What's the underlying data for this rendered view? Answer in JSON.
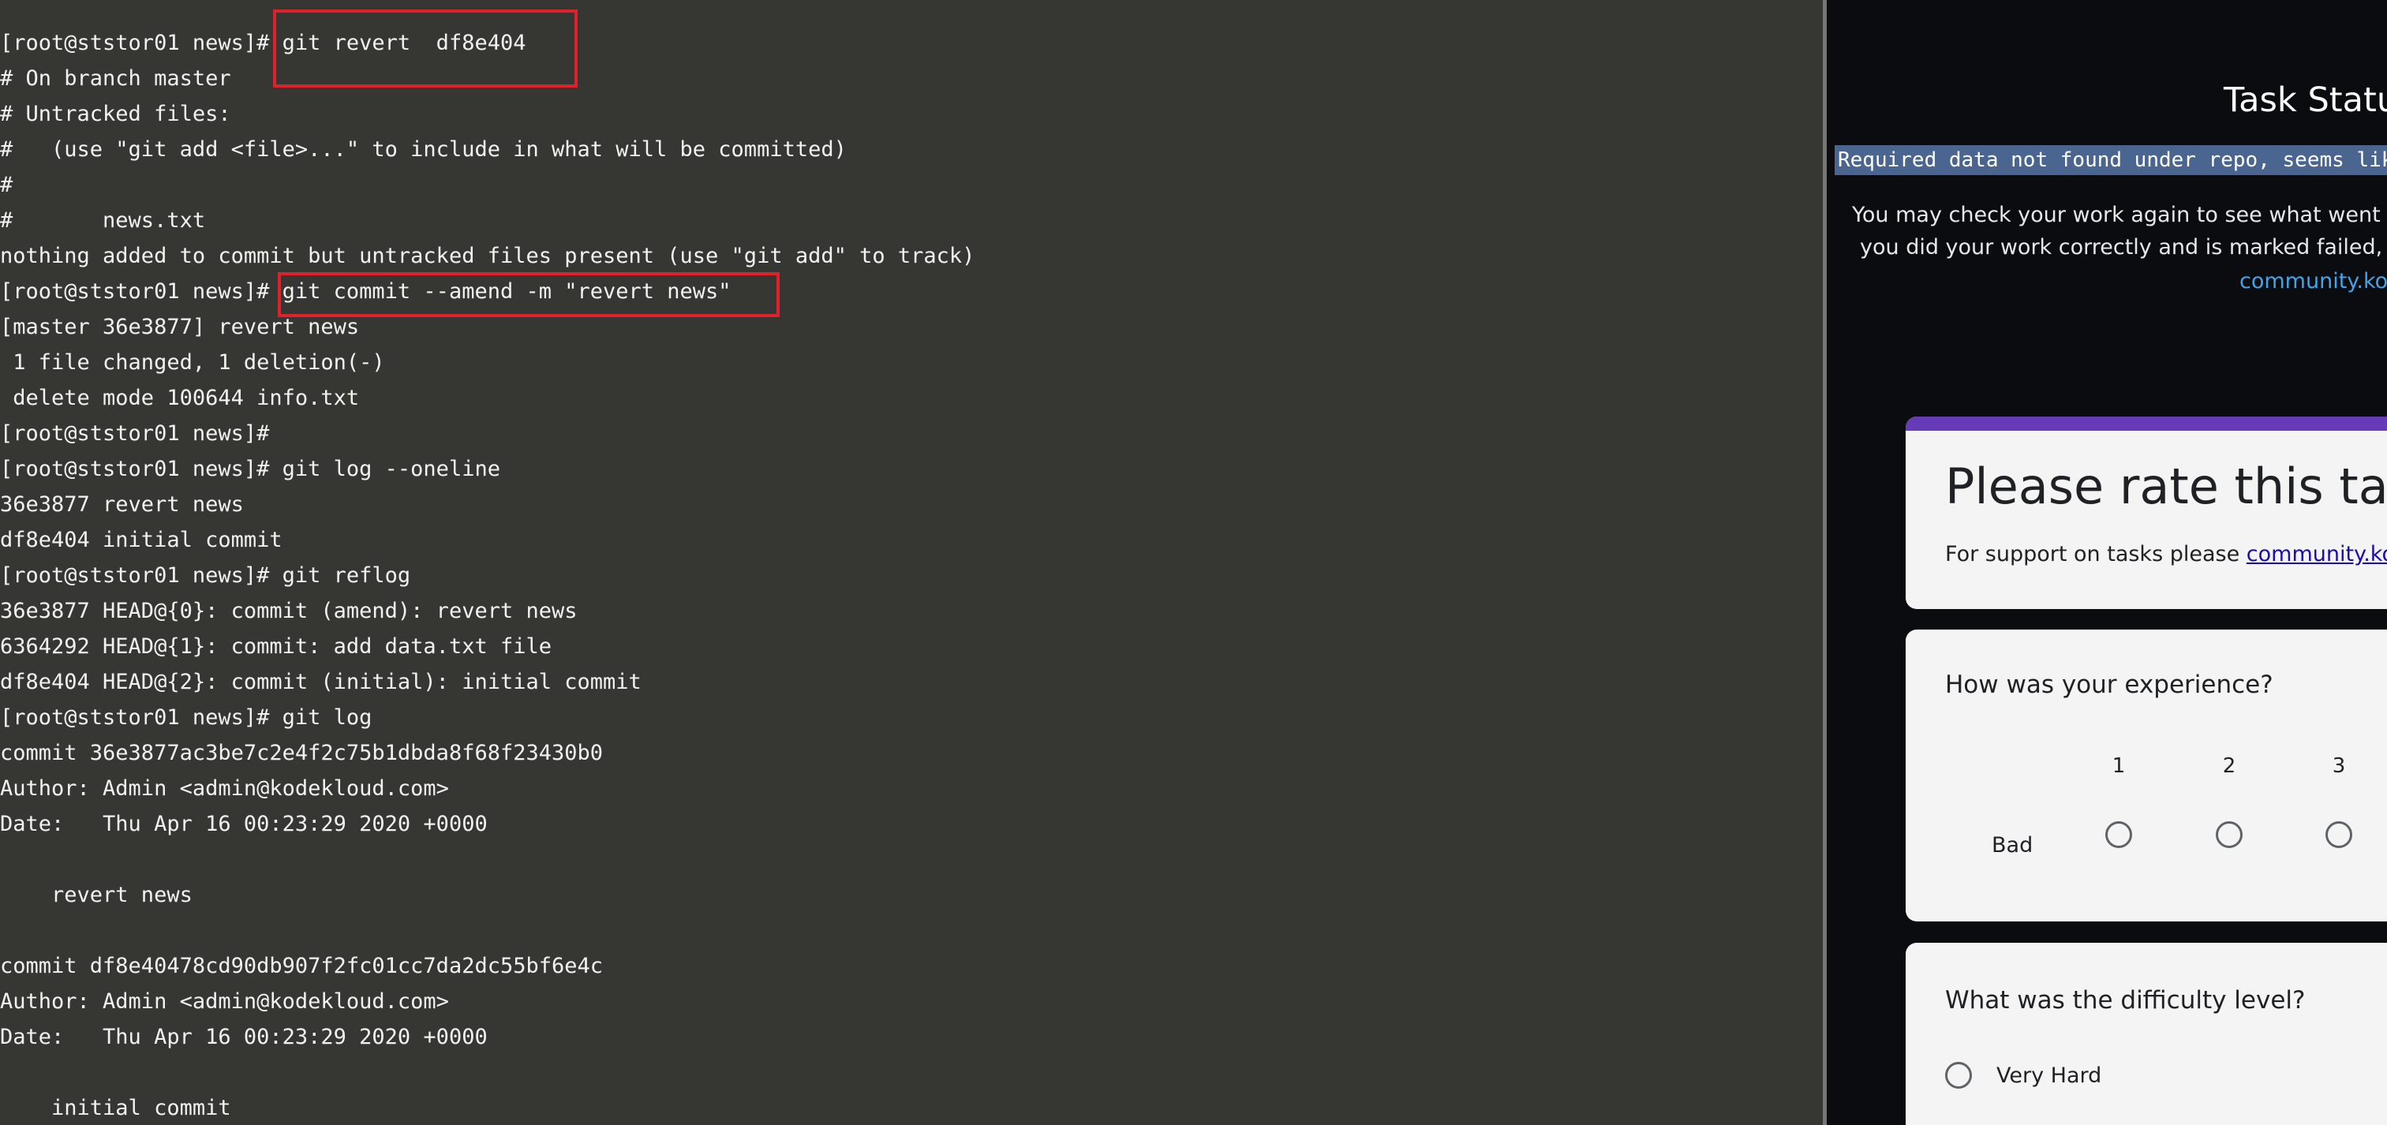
{
  "terminal": {
    "lines": [
      "[root@ststor01 news]# git revert  df8e404",
      "# On branch master",
      "# Untracked files:",
      "#   (use \"git add <file>...\" to include in what will be committed)",
      "#",
      "#       news.txt",
      "nothing added to commit but untracked files present (use \"git add\" to track)",
      "[root@ststor01 news]# git commit --amend -m \"revert news\"",
      "[master 36e3877] revert news",
      " 1 file changed, 1 deletion(-)",
      " delete mode 100644 info.txt",
      "[root@ststor01 news]#",
      "[root@ststor01 news]# git log --oneline",
      "36e3877 revert news",
      "df8e404 initial commit",
      "[root@ststor01 news]# git reflog",
      "36e3877 HEAD@{0}: commit (amend): revert news",
      "6364292 HEAD@{1}: commit: add data.txt file",
      "df8e404 HEAD@{2}: commit (initial): initial commit",
      "[root@ststor01 news]# git log",
      "commit 36e3877ac3be7c2e4f2c75b1dbda8f68f23430b0",
      "Author: Admin <admin@kodekloud.com>",
      "Date:   Thu Apr 16 00:23:29 2020 +0000",
      "",
      "    revert news",
      "",
      "commit df8e40478cd90db907f2fc01cc7da2dc55bf6e4c",
      "Author: Admin <admin@kodekloud.com>",
      "Date:   Thu Apr 16 00:23:29 2020 +0000",
      "",
      "    initial commit"
    ]
  },
  "task_panel": {
    "title": "Task Status",
    "status_message": "Required data not found under repo, seems like",
    "info_line_1": "You may check your work again to see what went wron",
    "info_line_2": "you did your work correctly and is marked failed, pleas",
    "info_link": "community.kod"
  },
  "rating_form": {
    "heading": "Please rate this task",
    "support_text": "For support on tasks please",
    "support_link": "community.kod",
    "q1": {
      "question": "How was your experience?",
      "scale_labels": [
        "1",
        "2",
        "3"
      ],
      "low_label": "Bad"
    },
    "q2": {
      "question": "What was the difficulty level?",
      "option_1": "Very Hard"
    }
  },
  "colors": {
    "terminal_bg": "#363632",
    "highlight_border": "#e0202a",
    "status_highlight": "#4a6690",
    "form_accent": "#673ab7"
  }
}
